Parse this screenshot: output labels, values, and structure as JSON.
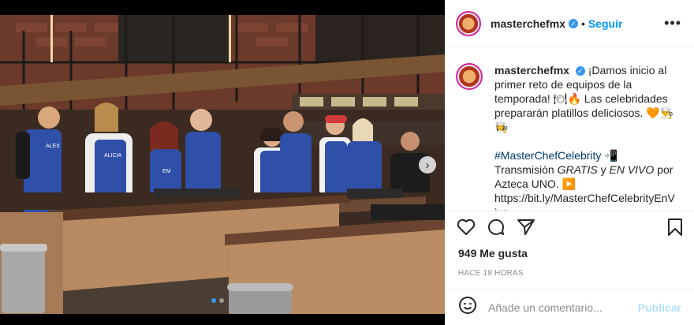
{
  "post": {
    "username": "masterchefmx",
    "follow_label": "Seguir",
    "separator": "•",
    "more_label": "•••",
    "caption": {
      "line1": "¡Damos inicio al primer reto de equipos de la temporada! 🍽🔥 Las celebridades prepararán platillos deliciosos. 🧡👨‍🍳👩‍🍳",
      "hashtag": "#MasterChefCelebrity",
      "line2_a": "📲 Transmisión",
      "line2_gratis": "GRATIS",
      "line2_y": " y ",
      "line2_envivo": "EN VIVO",
      "line2_b": " por Azteca UNO. ▶️",
      "link": "https://bit.ly/MasterChefCelebrityEnVivo"
    },
    "likes": "949 Me gusta",
    "timestamp": "HACE 18 HORAS",
    "comment_placeholder": "Añade un comentario...",
    "publish_label": "Publicar",
    "next_arrow": "›",
    "carousel": {
      "count": 2,
      "active": 0
    },
    "apron_labels": [
      "ALEX",
      "ALICIA",
      "EM",
      "",
      "",
      "",
      "",
      "",
      ""
    ]
  },
  "colors": {
    "accent": "#0095f6",
    "publish_disabled": "#b2dffc",
    "dot_active": "#3897f0",
    "apron_blue": "#2f4fa8"
  },
  "icons": [
    "heart-icon",
    "comment-icon",
    "share-icon",
    "bookmark-icon",
    "emoji-icon",
    "verified-icon",
    "chevron-right-icon"
  ]
}
